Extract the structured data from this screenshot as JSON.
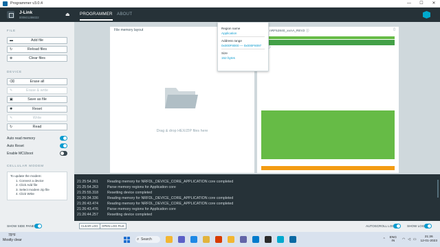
{
  "window": {
    "title": "Programmer v3.0.4",
    "controls": [
      "—",
      "☐",
      "✕"
    ]
  },
  "navbar": {
    "device_name": "J-Link",
    "device_serial": "000601286022",
    "eject_glyph": "⏏",
    "tabs": [
      {
        "label": "PROGRAMMER",
        "active": true
      },
      {
        "label": "ABOUT",
        "active": false
      }
    ]
  },
  "sidebar": {
    "file_section": "FILE",
    "file_buttons": [
      {
        "label": "Add file",
        "icon": "folder-icon",
        "glyph": "▬"
      },
      {
        "label": "Reload files",
        "icon": "reload-icon",
        "glyph": "↻"
      },
      {
        "label": "Clear files",
        "icon": "clear-icon",
        "glyph": "⊗"
      }
    ],
    "device_section": "DEVICE",
    "device_buttons": [
      {
        "label": "Erase all",
        "icon": "eraser-icon",
        "glyph": "⌫",
        "disabled": false
      },
      {
        "label": "Erase & write",
        "icon": "pencil-icon",
        "glyph": "✎",
        "disabled": true
      },
      {
        "label": "Save as file",
        "icon": "save-icon",
        "glyph": "▣",
        "disabled": false
      },
      {
        "label": "Reset",
        "icon": "reset-icon",
        "glyph": "✱",
        "disabled": false
      },
      {
        "label": "Write",
        "icon": "pencil-icon",
        "glyph": "✎",
        "disabled": true
      },
      {
        "label": "Read",
        "icon": "refresh-icon",
        "glyph": "↻",
        "disabled": false
      }
    ],
    "toggles": [
      {
        "label": "Auto read memory",
        "on": true
      },
      {
        "label": "Auto Reset",
        "on": true
      },
      {
        "label": "Enable MCUboot",
        "on": false
      }
    ],
    "modem_section": "CELLULAR MODEM",
    "modem_info": {
      "heading": "To update the modem:",
      "steps": [
        "1. Connect a device",
        "2. Click Add file",
        "3. Select modem zip file",
        "4. Click Write"
      ]
    }
  },
  "file_panel": {
    "header": "File memory layout",
    "drop_text": "Drag & drop HEX/ZIP files here"
  },
  "device_panel": {
    "header": "nRF52840_xxAA_REV2",
    "info_glyph": "ⓘ",
    "chip_glyph": "▯",
    "regions": [
      {
        "color": "#66bb46",
        "size": 0.02
      },
      {
        "color": "#43a047",
        "size": 0.04
      },
      {
        "color": "#ffffff",
        "size": 0.48
      },
      {
        "color": "#66bb46",
        "size": 0.37
      },
      {
        "color": "#ffffff",
        "size": 0.04
      },
      {
        "color": "#f39c12",
        "size": 0.03
      }
    ]
  },
  "tooltip": {
    "region_name_label": "Region name",
    "region_name": "Application",
    "address_label": "Address range",
    "address": "0x000F8000 — 0x000F8097",
    "size_label": "Size",
    "size": "152 bytes"
  },
  "log": {
    "entries": [
      {
        "time": "21:25:54.261",
        "msg": "Reading memory for NRFDL_DEVICE_CORE_APPLICATION core completed"
      },
      {
        "time": "21:25:54.263",
        "msg": "Parse memory regions for Application core"
      },
      {
        "time": "21:25:55.318",
        "msg": "Resetting device completed"
      },
      {
        "time": "21:26:34.336",
        "msg": "Reading memory for NRFDL_DEVICE_CORE_APPLICATION core completed"
      },
      {
        "time": "21:26:43.474",
        "msg": "Reading memory for NRFDL_DEVICE_CORE_APPLICATION core completed"
      },
      {
        "time": "21:26:43.476",
        "msg": "Parse memory regions for Application core"
      },
      {
        "time": "21:26:44.257",
        "msg": "Resetting device completed"
      }
    ]
  },
  "footer": {
    "show_side_panel": "SHOW SIDE PANEL",
    "clear_log": "CLEAR LOG",
    "open_log_file": "OPEN LOG FILE",
    "autoscroll_log": "AUTOSCROLL LOG",
    "show_log": "SHOW LOG"
  },
  "taskbar": {
    "temperature": "78°F",
    "condition": "Mostly clear",
    "search_label": "Search",
    "language_top": "ENG",
    "language_bottom": "IN",
    "time": "21:26",
    "date": "12-01-2023",
    "app_icons": [
      {
        "name": "file-explorer-icon",
        "color": "#f2b632"
      },
      {
        "name": "video-call-icon",
        "color": "#5b5fc7"
      },
      {
        "name": "browser-icon",
        "color": "#1e88e5"
      },
      {
        "name": "chrome-icon",
        "color": "#e2b33c"
      },
      {
        "name": "office-icon",
        "color": "#d83b01"
      },
      {
        "name": "folder-app-icon",
        "color": "#f2b632"
      },
      {
        "name": "teams-icon",
        "color": "#6264a7"
      },
      {
        "name": "vscode-icon",
        "color": "#007acc"
      },
      {
        "name": "terminal-icon",
        "color": "#2b2b2b"
      },
      {
        "name": "nrf-connect-icon",
        "color": "#00a9ce"
      },
      {
        "name": "programmer-icon",
        "color": "#0a69a3"
      }
    ]
  },
  "colors": {
    "accent": "#0a9bcf",
    "dark": "#263238",
    "sidebar": "#eceff1",
    "region_green": "#66bb46",
    "region_orange": "#f39c12"
  }
}
